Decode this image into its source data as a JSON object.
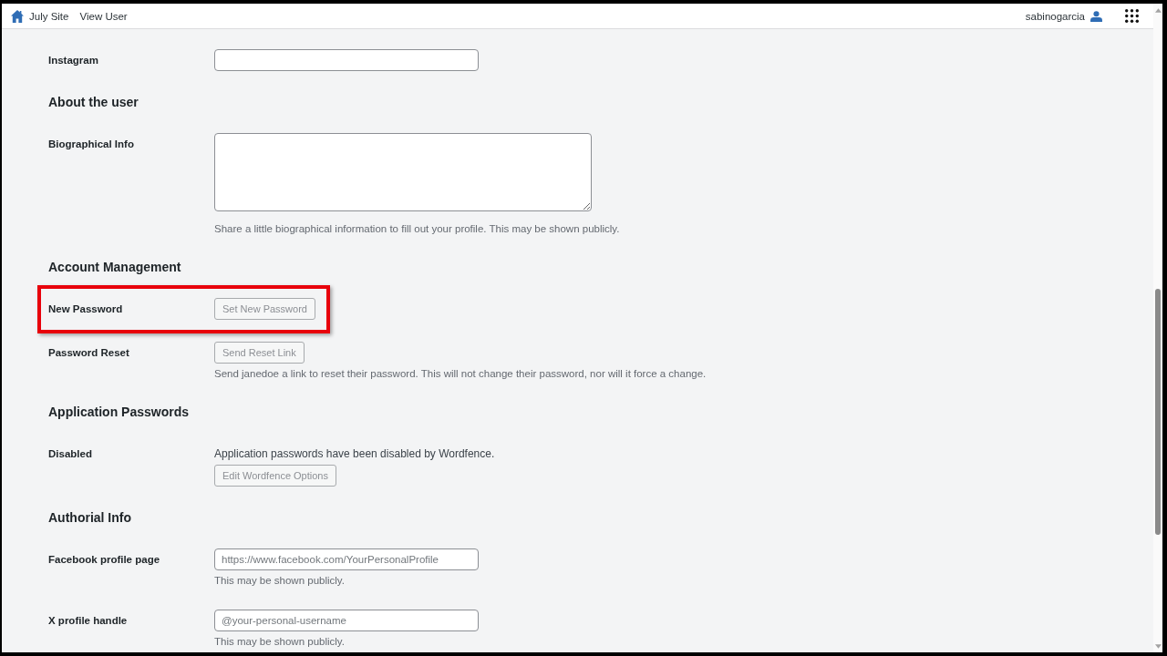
{
  "top_bar": {
    "links": [
      {
        "label": "July Site",
        "kind": "home"
      },
      {
        "label": "View User",
        "kind": "plain"
      }
    ],
    "account": {
      "username": "sabinogarcia"
    }
  },
  "sections": [
    {
      "rows": [
        {
          "label": "Instagram",
          "kind": "input",
          "highlighted": false
        }
      ]
    },
    {
      "heading": "About the user",
      "rows": [
        {
          "label": "Biographical Info",
          "kind": "textarea",
          "description": "Share a little biographical information to fill out your profile. This may be shown publicly.",
          "highlighted": false
        }
      ]
    },
    {
      "heading": "Account Management",
      "rows": [
        {
          "label": "New Password",
          "kind": "button",
          "button": "Set New Password",
          "highlighted": true
        },
        {
          "label": "Password Reset",
          "kind": "button",
          "button": "Send Reset Link",
          "description": "Send janedoe a link to reset their password. This will not change their password, nor will it force a change.",
          "highlighted": false
        }
      ]
    },
    {
      "heading": "Application Passwords",
      "rows": [
        {
          "label": "Disabled",
          "kind": "notice",
          "text": "Application passwords have been disabled by Wordfence.",
          "button": "Edit Wordfence Options",
          "highlighted": false
        }
      ]
    },
    {
      "heading": "Authorial Info",
      "rows": [
        {
          "label": "Facebook profile page",
          "kind": "input",
          "placeholder": "https://www.facebook.com/YourPersonalProfile",
          "description": "This may be shown publicly.",
          "highlighted": false
        },
        {
          "label": "X profile handle",
          "kind": "input",
          "placeholder": "@your-personal-username",
          "description": "This may be shown publicly.",
          "highlighted": false
        }
      ]
    }
  ]
}
